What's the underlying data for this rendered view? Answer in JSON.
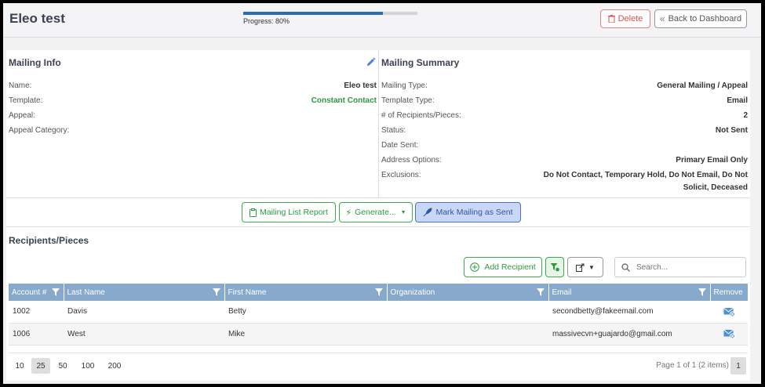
{
  "header": {
    "title": "Eleo test",
    "progress_label": "Progress: 80%",
    "progress_fraction": 0.8,
    "delete_label": "Delete",
    "back_label": "Back to Dashboard"
  },
  "mailing_info": {
    "title": "Mailing Info",
    "rows": [
      {
        "key": "Name:",
        "value": "Eleo test"
      },
      {
        "key": "Template:",
        "value": "Constant Contact"
      },
      {
        "key": "Appeal:",
        "value": ""
      },
      {
        "key": "Appeal Category:",
        "value": ""
      }
    ]
  },
  "mailing_summary": {
    "title": "Mailing Summary",
    "rows": [
      {
        "key": "Mailing Type:",
        "value": "General Mailing / Appeal"
      },
      {
        "key": "Template Type:",
        "value": "Email"
      },
      {
        "key": "# of Recipients/Pieces:",
        "value": "2"
      },
      {
        "key": "Status:",
        "value": "Not Sent"
      },
      {
        "key": "Date Sent:",
        "value": ""
      },
      {
        "key": "Address Options:",
        "value": "Primary Email Only"
      },
      {
        "key": "Exclusions:",
        "value_line1": "Do Not Contact, Temporary Hold, Do Not Email, Do Not",
        "value_line2": "Solicit, Deceased"
      }
    ]
  },
  "actions": {
    "report_label": "Mailing List Report",
    "generate_label": "Generate...",
    "mark_sent_label": "Mark Mailing as Sent"
  },
  "recipients": {
    "title": "Recipients/Pieces",
    "add_label": "Add Recipient",
    "search_placeholder": "Search...",
    "columns": [
      "Account #",
      "Last Name",
      "First Name",
      "Organization",
      "Email",
      "Remove"
    ],
    "rows": [
      {
        "account": "1002",
        "last": "Davis",
        "first": "Betty",
        "org": "",
        "email": "secondbetty@fakeemail.com"
      },
      {
        "account": "1006",
        "last": "West",
        "first": "Mike",
        "org": "",
        "email": "massivecvn+guajardo@gmail.com"
      }
    ],
    "page_sizes": [
      "10",
      "25",
      "50",
      "100",
      "200"
    ],
    "selected_page_size": "25",
    "page_info": "Page 1 of 1 (2 items)",
    "current_page": "1"
  },
  "colors": {
    "accent_blue": "#2e6bb5",
    "green": "#2e9a3e",
    "header_row": "#87a9cc",
    "delete_red": "#d9534f"
  }
}
